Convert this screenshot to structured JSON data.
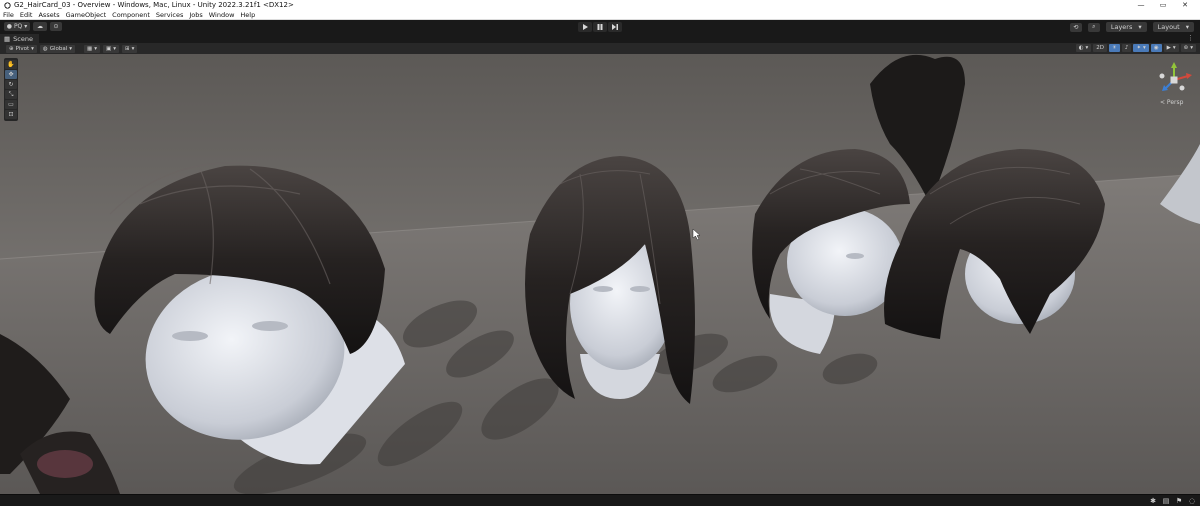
{
  "window": {
    "title": "G2_HairCard_03 - Overview - Windows, Mac, Linux - Unity 2022.3.21f1 <DX12>",
    "controls": {
      "minimize": "—",
      "maximize": "▭",
      "close": "✕"
    }
  },
  "menu": {
    "items": [
      {
        "label": "File"
      },
      {
        "label": "Edit"
      },
      {
        "label": "Assets"
      },
      {
        "label": "GameObject"
      },
      {
        "label": "Component"
      },
      {
        "label": "Services"
      },
      {
        "label": "Jobs"
      },
      {
        "label": "Window"
      },
      {
        "label": "Help"
      }
    ]
  },
  "toolbar": {
    "account_label": "PQ",
    "layers_label": "Layers",
    "layout_label": "Layout",
    "play_icon": "play-icon",
    "pause_icon": "pause-icon",
    "step_icon": "step-icon"
  },
  "scene": {
    "tab_label": "Scene",
    "pivot_label": "Pivot",
    "global_label": "Global",
    "mode_2d_label": "2D",
    "persp_label": "< Persp"
  },
  "colors": {
    "accent_blue": "#4a7ab8",
    "editor_dark": "#191919",
    "panel": "#282828",
    "gizmo_x": "#d2493c",
    "gizmo_y": "#92c53a",
    "gizmo_z": "#3b7fd6"
  }
}
